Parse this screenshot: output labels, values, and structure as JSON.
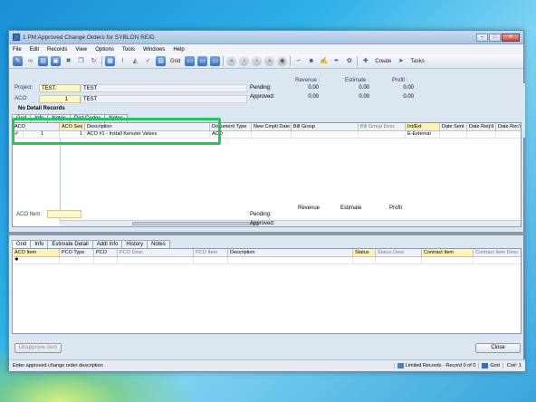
{
  "window": {
    "title": "1 PM Approved Change Orders for SYBLON REID",
    "min": "–",
    "max": "□",
    "close": "✕"
  },
  "menu": [
    "File",
    "Edit",
    "Records",
    "View",
    "Options",
    "Tools",
    "Windows",
    "Help"
  ],
  "toolbar": {
    "grid_label": "Grid",
    "create_label": "Create",
    "tasks_label": "Tasks"
  },
  "header": {
    "project_label": "Project:",
    "project_value": "TEST.",
    "project_desc": "TEST",
    "aco_label": "ACO:",
    "aco_value": "1",
    "aco_desc": "TEST",
    "no_detail": "No Detail Records",
    "revenue_label": "Revenue :",
    "estimate_label": "Estimate :",
    "profit_label": "Profit :",
    "pending_label": "Pending:",
    "approved_label": "Approved:",
    "pending": [
      "0.00",
      "0.00",
      "0.00"
    ],
    "approved": [
      "0.00",
      "0.00",
      "0.00"
    ]
  },
  "top_tabs": [
    "Grid",
    "Info",
    "Notes",
    "Dist Codes",
    "Notes"
  ],
  "top_grid": {
    "headers": [
      "ACO",
      "ACO Seq",
      "Description",
      "Document Type",
      "New Cmplt Date",
      "Bill Group",
      "Bill Group Desc",
      "Int/Ext",
      "Date Sent",
      "Date Req'd",
      "Date Rec'd"
    ],
    "row": {
      "marker": "✐",
      "aco": "1",
      "seq": "1",
      "description": "ACO #1 - Install Kenuter Valves",
      "doc_type": "ACO",
      "int_ext": "E-External"
    }
  },
  "detail": {
    "aco_item_label": "ACO Item:",
    "revenue_label": "Revenue",
    "estimate_label": "Estimate",
    "profit_label": "Profit",
    "pending_label": "Pending:",
    "approved_label": "Approved:"
  },
  "bottom_tabs": [
    "Grid",
    "Info",
    "Estimate Detail",
    "Addl Info",
    "History",
    "Notes"
  ],
  "bottom_grid": {
    "headers": [
      "ACO Item",
      "PCO Type",
      "PCO",
      "PCO Desc",
      "PCO Item",
      "Description",
      "Status",
      "Status Desc",
      "Contract Item",
      "Contract Item Desc"
    ],
    "new_marker": "✱"
  },
  "buttons": {
    "unapprove": "Unapprove Item",
    "close": "Close"
  },
  "status": {
    "message": "Enter approved change order description",
    "limited": "Limited Records - Record 0 of 0",
    "grid": "Grid",
    "company": "Co#: 1"
  }
}
